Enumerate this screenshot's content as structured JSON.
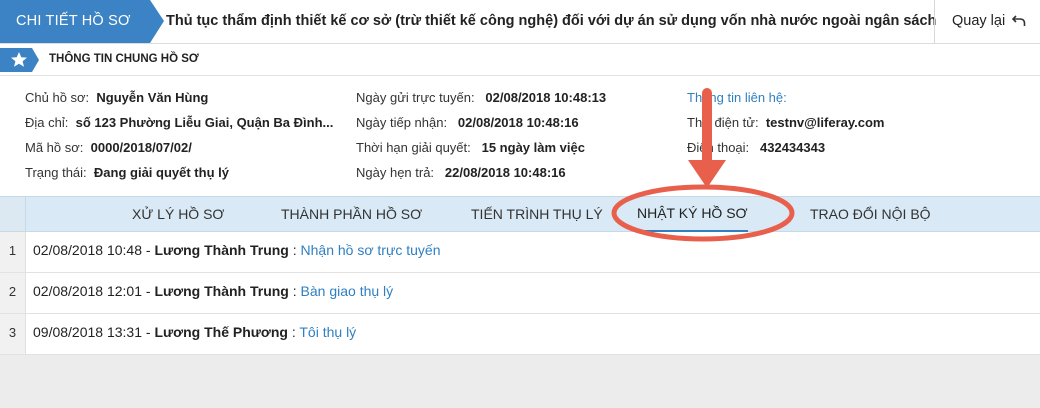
{
  "header": {
    "breadcrumb": "CHI TIẾT HỒ SƠ",
    "title": "Thủ tục thẩm định thiết kế cơ sở (trừ thiết kế công nghệ) đối với dự án sử dụng vốn nhà nước ngoài ngân sách",
    "back_label": "Quay lại",
    "accent": "#3b83c4"
  },
  "section": {
    "title": "THÔNG TIN CHUNG HỒ SƠ"
  },
  "info": {
    "col1": [
      {
        "label": "Chủ hồ sơ:",
        "value": "Nguyễn Văn Hùng"
      },
      {
        "label": "Địa chỉ:",
        "value": "số 123 Phường Liễu Giai, Quận Ba Đình..."
      },
      {
        "label": "Mã hồ sơ:",
        "value": "0000/2018/07/02/"
      },
      {
        "label": "Trạng thái:",
        "value": "Đang giải quyết thụ lý"
      }
    ],
    "col2": [
      {
        "label": "Ngày gửi trực tuyến:",
        "value": "02/08/2018 10:48:13"
      },
      {
        "label": "Ngày tiếp nhận:",
        "value": "02/08/2018 10:48:16"
      },
      {
        "label": "Thời hạn giải quyết:",
        "value": "15 ngày làm việc"
      },
      {
        "label": "Ngày hẹn trả:",
        "value": "22/08/2018 10:48:16"
      }
    ],
    "col3": {
      "contact_link": "Thông tin liên hệ:",
      "email_label": "Thư điện tử:",
      "email_value": "testnv@liferay.com",
      "phone_label": "Điện thoại:",
      "phone_value": "432434343"
    }
  },
  "tabs": [
    {
      "label": "XỬ LÝ HỒ SƠ"
    },
    {
      "label": "THÀNH PHẦN HỒ SƠ"
    },
    {
      "label": "TIẾN TRÌNH THỤ LÝ"
    },
    {
      "label": "NHẬT KÝ HỒ SƠ",
      "active": true
    },
    {
      "label": "TRAO ĐỔI NỘI BỘ"
    }
  ],
  "log": [
    {
      "index": "1",
      "time": "02/08/2018 10:48",
      "user": "Lương Thành Trung",
      "action": "Nhận hồ sơ trực tuyến"
    },
    {
      "index": "2",
      "time": "02/08/2018 12:01",
      "user": "Lương Thành Trung",
      "action": "Bàn giao thụ lý"
    },
    {
      "index": "3",
      "time": "09/08/2018 13:31",
      "user": "Lương Thế Phương",
      "action": "Tôi thụ lý"
    }
  ],
  "annotation": {
    "color": "#e8604c"
  }
}
